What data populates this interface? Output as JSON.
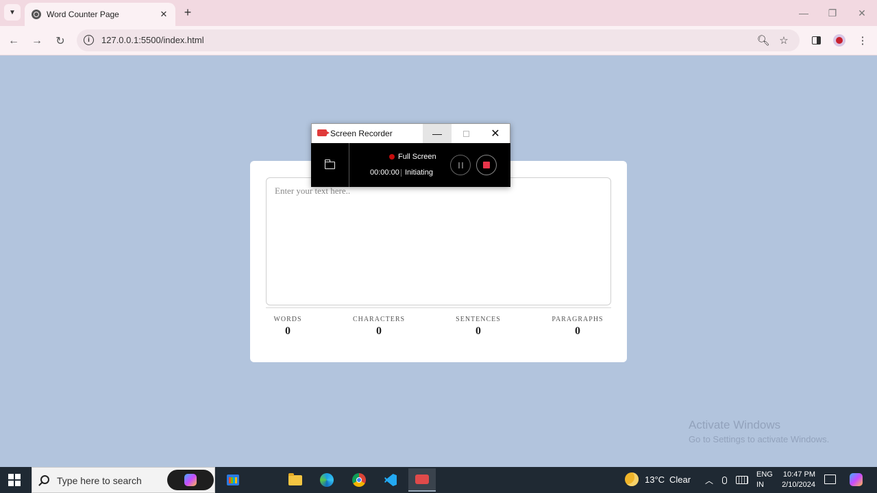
{
  "browser": {
    "tab_title": "Word Counter Page",
    "url": "127.0.0.1:5500/index.html",
    "tab_close_glyph": "✕",
    "new_tab_glyph": "+",
    "window_controls": [
      "—",
      "❐",
      "✕"
    ]
  },
  "page": {
    "textarea_placeholder": "Enter your text here..",
    "textarea_value": "",
    "stats": [
      {
        "label": "WORDS",
        "value": "0"
      },
      {
        "label": "CHARACTERS",
        "value": "0"
      },
      {
        "label": "SENTENCES",
        "value": "0"
      },
      {
        "label": "PARAGRAPHS",
        "value": "0"
      }
    ]
  },
  "recorder": {
    "title": "Screen Recorder",
    "mode": "Full Screen",
    "time": "00:00:00",
    "status": "Initiating",
    "min_glyph": "—",
    "close_glyph": "✕"
  },
  "watermark": {
    "title": "Activate Windows",
    "subtitle": "Go to Settings to activate Windows."
  },
  "taskbar": {
    "search_placeholder": "Type here to search",
    "weather_temp": "13°C",
    "weather_condition": "Clear",
    "lang_line1": "ENG",
    "lang_line2": "IN",
    "time": "10:47 PM",
    "date": "2/10/2024",
    "apps": [
      "microsoft-store",
      "file-explorer",
      "edge",
      "chrome",
      "vscode",
      "screen-recorder"
    ]
  },
  "colors": {
    "page_background": "#b2c4dd",
    "tabbar": "#f2d9e1",
    "taskbar": "#1f2933",
    "record_dot": "#c40c0c",
    "stop_button": "#e8344a"
  }
}
